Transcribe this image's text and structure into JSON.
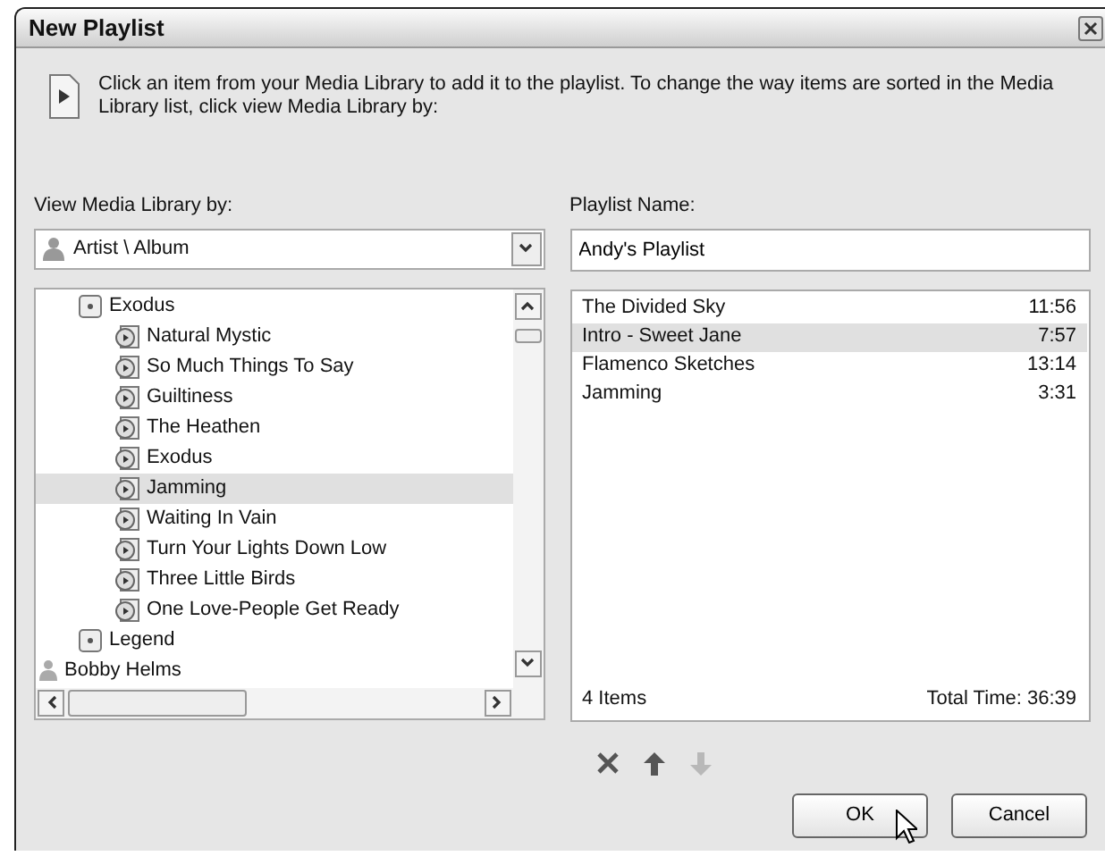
{
  "window": {
    "title": "New Playlist"
  },
  "intro": "Click an item from your Media Library to add it to the playlist. To change the way items are sorted in the Media Library list, click view Media Library by:",
  "library": {
    "label": "View Media Library by:",
    "value": "Artist \\ Album",
    "tree": [
      {
        "label": "Exodus",
        "kind": "album",
        "selected": false,
        "children": [
          {
            "label": "Natural Mystic",
            "kind": "track",
            "selected": false
          },
          {
            "label": "So Much Things To Say",
            "kind": "track",
            "selected": false
          },
          {
            "label": "Guiltiness",
            "kind": "track",
            "selected": false
          },
          {
            "label": "The Heathen",
            "kind": "track",
            "selected": false
          },
          {
            "label": "Exodus",
            "kind": "track",
            "selected": false
          },
          {
            "label": "Jamming",
            "kind": "track",
            "selected": true
          },
          {
            "label": "Waiting In Vain",
            "kind": "track",
            "selected": false
          },
          {
            "label": "Turn Your Lights Down Low",
            "kind": "track",
            "selected": false
          },
          {
            "label": "Three Little Birds",
            "kind": "track",
            "selected": false
          },
          {
            "label": "One Love-People Get Ready",
            "kind": "track",
            "selected": false
          }
        ]
      },
      {
        "label": "Legend",
        "kind": "album",
        "selected": false
      },
      {
        "label": "Bobby Helms",
        "kind": "artist",
        "selected": false
      }
    ]
  },
  "playlist": {
    "label": "Playlist Name:",
    "value": "Andy's Playlist",
    "items": [
      {
        "title": "The Divided Sky",
        "time": "11:56",
        "selected": false
      },
      {
        "title": "Intro - Sweet Jane",
        "time": "7:57",
        "selected": true
      },
      {
        "title": "Flamenco Sketches",
        "time": "13:14",
        "selected": false
      },
      {
        "title": "Jamming",
        "time": "3:31",
        "selected": false
      }
    ],
    "count": "4 Items",
    "total": "Total Time: 36:39"
  },
  "tools": [
    {
      "kind": "remove",
      "disabled": false
    },
    {
      "kind": "up",
      "disabled": false
    },
    {
      "kind": "down",
      "disabled": true
    }
  ],
  "buttons": [
    "OK",
    "Cancel"
  ]
}
